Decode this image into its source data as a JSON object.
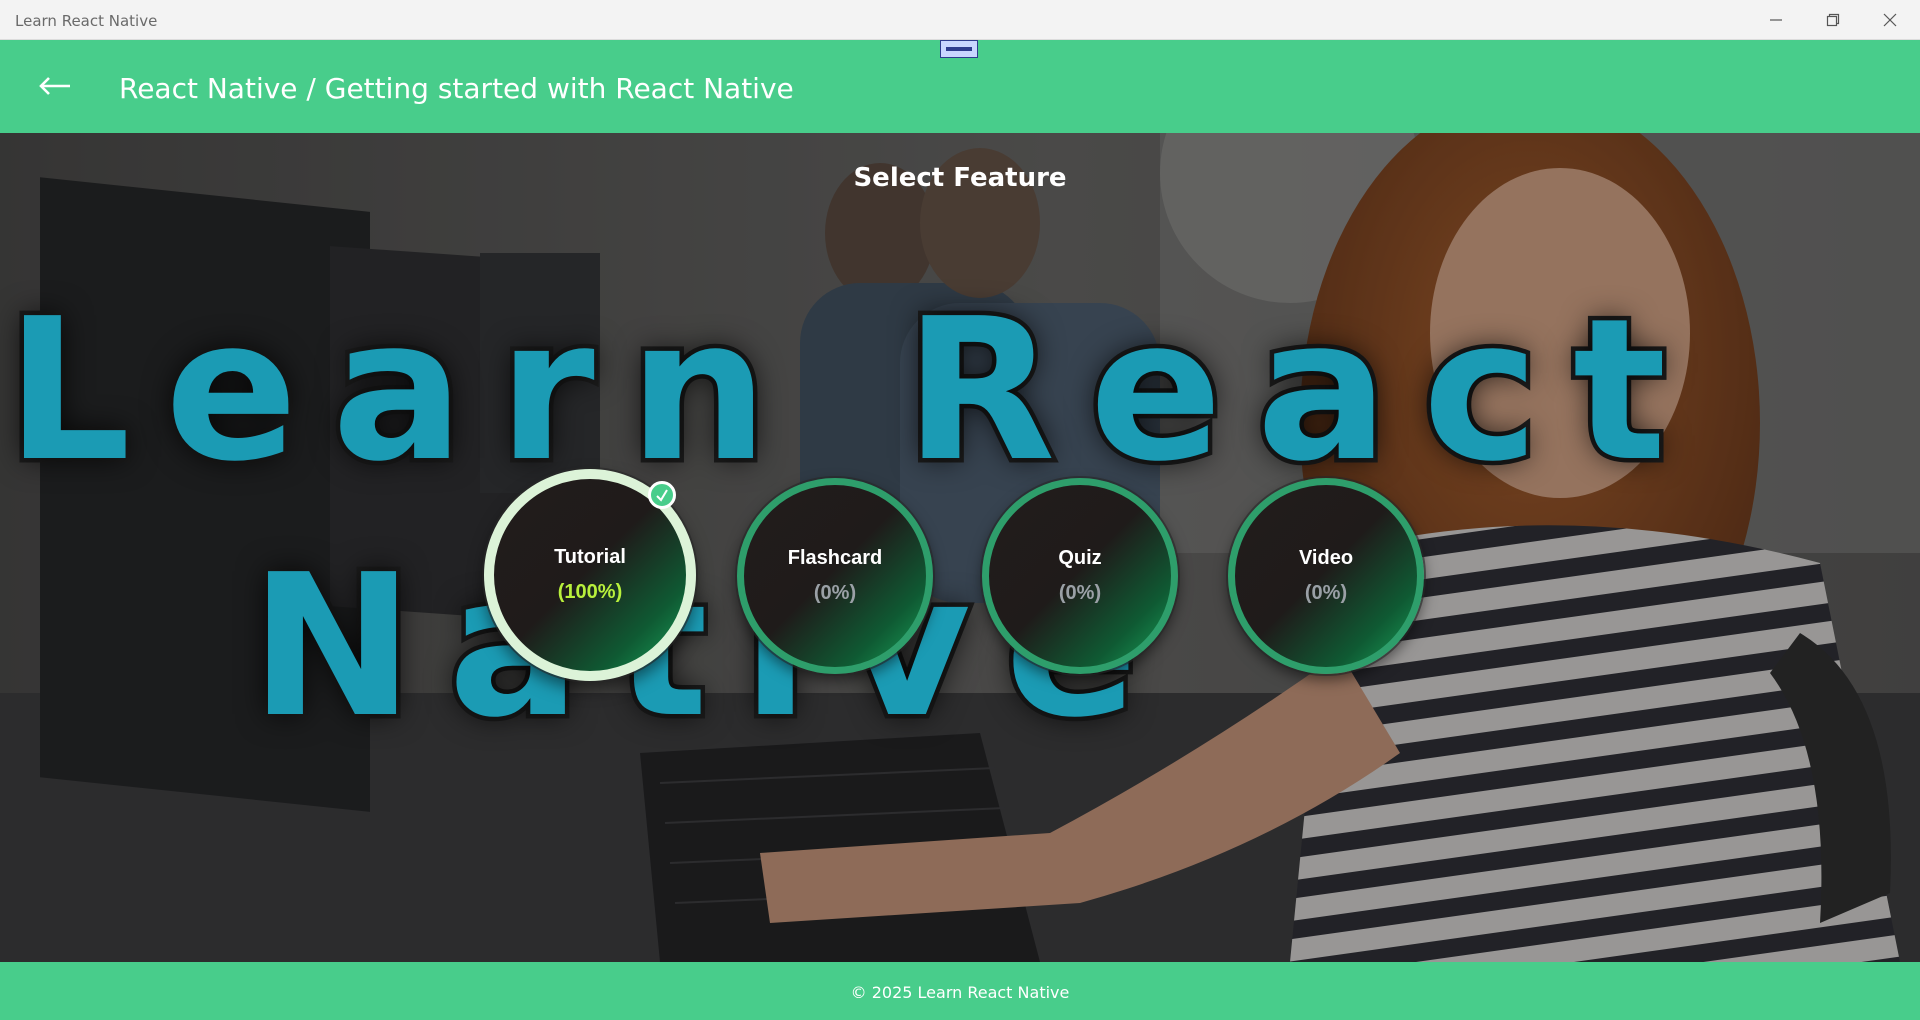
{
  "window": {
    "title": "Learn React Native",
    "controls": {
      "minimize_icon": "minimize-icon",
      "maximize_icon": "restore-icon",
      "close_icon": "close-icon"
    }
  },
  "header": {
    "back_icon": "arrow-left-icon",
    "breadcrumb": "React Native / Getting started with React Native",
    "background_color": "#48cd8b"
  },
  "main": {
    "section_title": "Select Feature",
    "background_text": [
      "Learn React",
      "Native"
    ],
    "features": [
      {
        "label": "Tutorial",
        "progress": "(100%)",
        "selected": true,
        "badge_icon": "check-icon"
      },
      {
        "label": "Flashcard",
        "progress": "(0%)",
        "selected": false
      },
      {
        "label": "Quiz",
        "progress": "(0%)",
        "selected": false
      },
      {
        "label": "Video",
        "progress": "(0%)",
        "selected": false
      }
    ]
  },
  "footer": {
    "text": "© 2025 Learn React Native"
  },
  "colors": {
    "accent": "#48cd8b",
    "complete_progress": "#b8f03c",
    "incomplete_progress": "#9aa0a6",
    "selected_ring": "#dcf3d8"
  }
}
